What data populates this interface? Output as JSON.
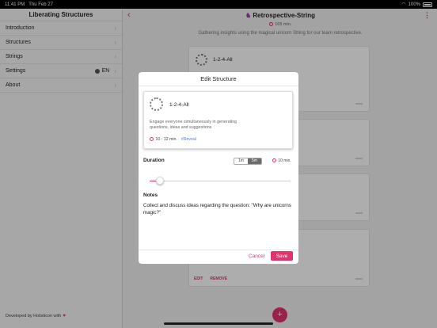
{
  "status_bar": {
    "time": "11:41 PM",
    "date": "Thu Feb 27",
    "battery": "100%"
  },
  "sidebar": {
    "title": "Liberating Structures",
    "items": [
      {
        "label": "Introduction"
      },
      {
        "label": "Structures"
      },
      {
        "label": "Strings"
      },
      {
        "label": "Settings",
        "value": "EN"
      },
      {
        "label": "About"
      }
    ],
    "footer": "Developed by Holisticon with"
  },
  "main": {
    "title": "Retrospective-String",
    "duration": "165 min.",
    "subtitle": "Gathering insights using the magical unicorn String for our team retrospective.",
    "first_card_name": "1-2-4-All",
    "edit_label": "EDIT",
    "remove_label": "REMOVE",
    "fab_label": "+"
  },
  "modal": {
    "title": "Edit Structure",
    "card": {
      "name": "1-2-4-All",
      "description": "Engage everyone simultaneously in generating questions, ideas and suggestions",
      "time": "10 - 12 min.",
      "tag": "#Reveal"
    },
    "duration_label": "Duration",
    "segments": [
      {
        "label": "1m"
      },
      {
        "label": "5m"
      }
    ],
    "selected_segment": "5m",
    "duration_value": "10 min.",
    "slider_fraction": 0.05,
    "notes_label": "Notes",
    "notes_text": "Collect and discuss ideas regarding the question: \"Why are unicorns magic?\"",
    "cancel_label": "Cancel",
    "save_label": "Save"
  },
  "colors": {
    "accent": "#e0336b",
    "tag": "#5577cc"
  },
  "icons": [
    "back-icon",
    "more-icon",
    "clock-icon",
    "globe-icon",
    "chevron-right-icon",
    "heart-icon",
    "unicorn-icon",
    "wifi-icon",
    "battery-icon"
  ]
}
